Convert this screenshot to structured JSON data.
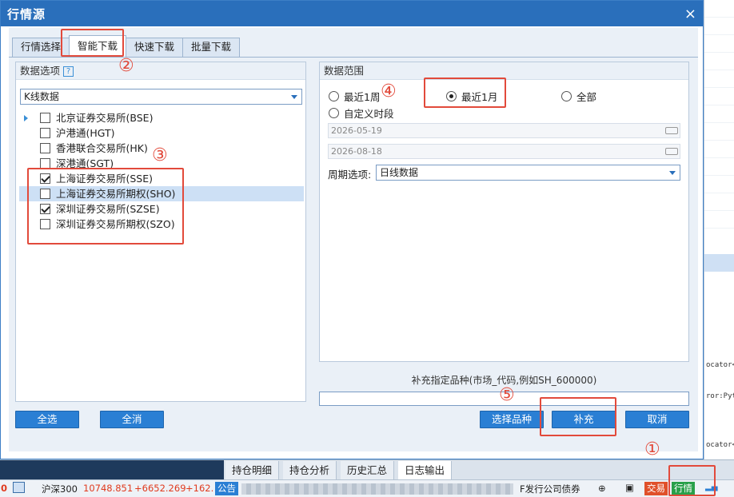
{
  "dialog": {
    "title": "行情源",
    "close_label": "×",
    "tabs": [
      "行情选择",
      "智能下载",
      "快速下载",
      "批量下载"
    ],
    "active_tab": 1
  },
  "left": {
    "header": "数据选项",
    "help_label": "?",
    "select_value": "K线数据",
    "items": [
      {
        "label": "北京证券交易所(BSE)",
        "checked": false,
        "expandable": true
      },
      {
        "label": "沪港通(HGT)",
        "checked": false,
        "expandable": false
      },
      {
        "label": "香港联合交易所(HK)",
        "checked": false,
        "expandable": false
      },
      {
        "label": "深港通(SGT)",
        "checked": false,
        "expandable": false
      },
      {
        "label": "上海证券交易所(SSE)",
        "checked": true,
        "expandable": false
      },
      {
        "label": "上海证券交易所期权(SHO)",
        "checked": false,
        "expandable": false,
        "selected": true
      },
      {
        "label": "深圳证券交易所(SZSE)",
        "checked": true,
        "expandable": false
      },
      {
        "label": "深圳证券交易所期权(SZO)",
        "checked": false,
        "expandable": false
      }
    ]
  },
  "right": {
    "header": "数据范围",
    "radio_week": "最近1周",
    "radio_month": "最近1月",
    "radio_all": "全部",
    "radio_custom": "自定义时段",
    "date_start": "2026-05-19",
    "date_end": "2026-08-18",
    "period_label": "周期选项:",
    "period_value": "日线数据"
  },
  "supplement": {
    "label": "补充指定品种(市场_代码,例如SH_600000)",
    "value": ""
  },
  "buttons": {
    "select_all": "全选",
    "clear_all": "全消",
    "choose": "选择品种",
    "supplement": "补充",
    "cancel": "取消"
  },
  "markers": {
    "m1": "①",
    "m2": "②",
    "m3": "③",
    "m4": "④",
    "m5": "⑤"
  },
  "bottom_tabs": [
    "持仓明细",
    "持仓分析",
    "历史汇总",
    "日志输出"
  ],
  "status": {
    "zero": "0",
    "index_name": "沪深300",
    "index_value": "10748.851",
    "change1": "+6652.269",
    "change2": "+162.",
    "notice": "公告",
    "news": "F发行公司债券",
    "trade": "交易",
    "quote": "行情"
  },
  "background": {
    "code_lines": [
      "ocator<",
      "ror:Pyt",
      "ocator<"
    ]
  },
  "colors": {
    "accent": "#2a6fbb",
    "button": "#2a7fd4",
    "annotation": "#e24a3b"
  }
}
